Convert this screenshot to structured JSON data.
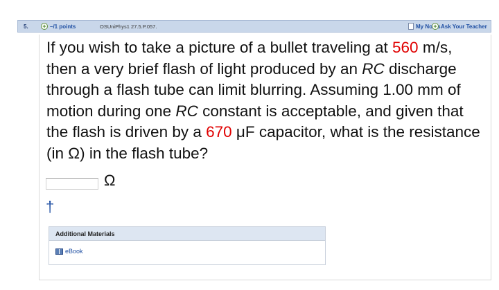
{
  "header": {
    "question_number": "5.",
    "points": "–/1 points",
    "source": "OSUniPhys1 27.5.P.057.",
    "my_notes": "My Notes",
    "ask_teacher": "Ask Your Teacher"
  },
  "question": {
    "t1": "If you wish to take a picture of a bullet traveling at ",
    "speed": "560",
    "t2": " m/s, then a very brief flash of light produced by an ",
    "rc1": "RC",
    "t3": " discharge through a flash tube can limit blurring. Assuming 1.00 mm of motion during one ",
    "rc2": "RC",
    "t4": " constant is acceptable, and given that the flash is driven by a ",
    "capacitance": "670",
    "t5": " μF capacitor, what is the resistance (in Ω) in the flash tube?"
  },
  "answer": {
    "value": "",
    "unit": "Ω"
  },
  "dagger": "†",
  "additional": {
    "title": "Additional Materials",
    "ebook": "eBook"
  },
  "colors": {
    "header_bg": "#c9d7ea",
    "link": "#1f4fa3",
    "highlight": "#e00000"
  }
}
